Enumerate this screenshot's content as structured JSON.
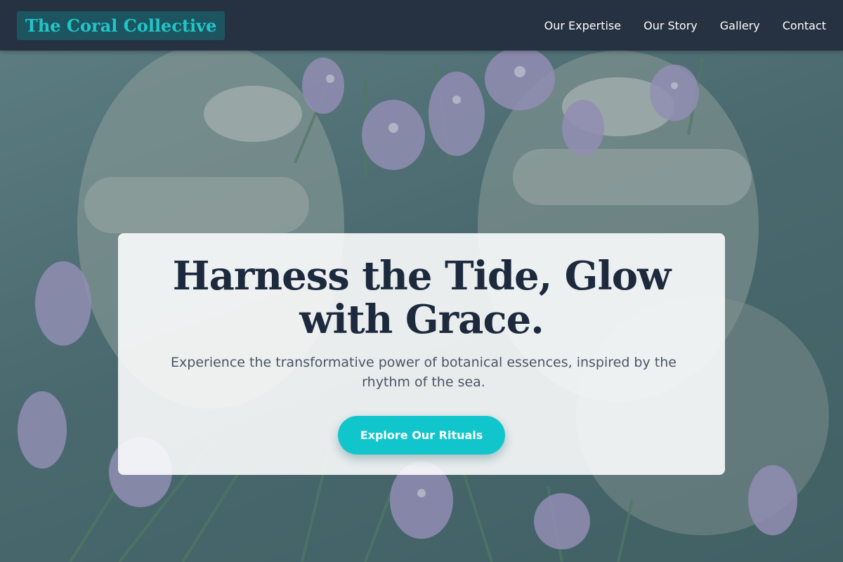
{
  "brand": {
    "name": "The Coral Collective"
  },
  "nav": {
    "items": [
      {
        "label": "Our Expertise"
      },
      {
        "label": "Our Story"
      },
      {
        "label": "Gallery"
      },
      {
        "label": "Contact"
      }
    ]
  },
  "hero": {
    "headline": "Harness the Tide, Glow with Grace.",
    "subtext": "Experience the transformative power of botanical essences, inspired by the rhythm of the sea.",
    "cta_label": "Explore Our Rituals"
  },
  "colors": {
    "nav_bg": "#263141",
    "brand_text": "#21c5c8",
    "cta": "#10c6cc",
    "headline": "#1d2a3e"
  }
}
